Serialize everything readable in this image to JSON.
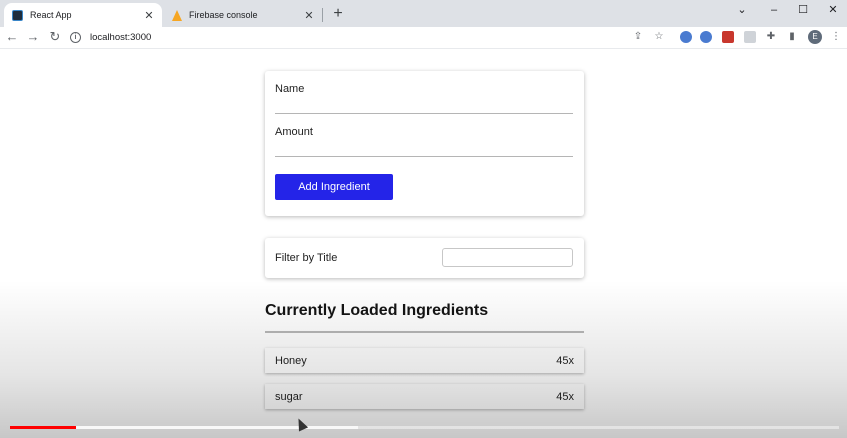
{
  "browser": {
    "tabs": [
      {
        "title": "React App",
        "favicon": "react-favicon",
        "active": true
      },
      {
        "title": "Firebase console",
        "favicon": "firebase-favicon",
        "active": false
      }
    ],
    "tab_close_symbol": "✕",
    "new_tab_symbol": "+",
    "window_controls": {
      "tab_search": "⌄",
      "minimize": "–",
      "maximize": "☐",
      "close": "✕"
    },
    "url": "localhost:3000",
    "profile_initial": "E"
  },
  "form": {
    "name_label": "Name",
    "amount_label": "Amount",
    "add_button_label": "Add Ingredient"
  },
  "filter": {
    "label": "Filter by Title",
    "value": ""
  },
  "ingredients": {
    "heading": "Currently Loaded Ingredients",
    "items": [
      {
        "title": "Honey",
        "amount": "45x"
      },
      {
        "title": "sugar",
        "amount": "45x"
      }
    ]
  },
  "video": {
    "played_fraction": 0.08,
    "buffered_fraction": 0.42,
    "colors": {
      "played": "#ff0000"
    }
  },
  "colors": {
    "primary_button": "#2424e8",
    "tabstrip": "#dee1e6"
  }
}
